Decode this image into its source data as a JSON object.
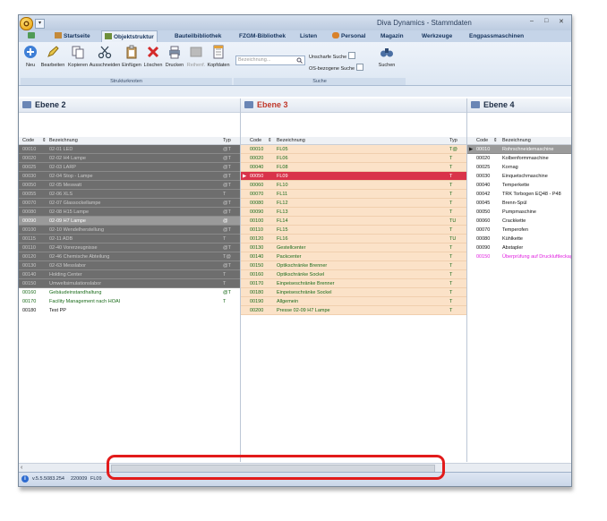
{
  "window_title": "Diva Dynamics - Stammdaten",
  "window_controls": [
    "–",
    "□",
    "✕"
  ],
  "quick_access": "▾",
  "tabs": [
    {
      "label": "Startseite"
    },
    {
      "label": "Objektstruktur"
    },
    {
      "label": "Bauteilbibliothek"
    },
    {
      "label": "FZGM-Bibliothek"
    },
    {
      "label": "Listen"
    },
    {
      "label": "Personal"
    },
    {
      "label": "Magazin"
    },
    {
      "label": "Werkzeuge"
    },
    {
      "label": "Engpassmaschinen"
    }
  ],
  "ribbon": {
    "buttons": [
      "Neu",
      "Bearbeiten",
      "Kopieren",
      "Ausschneiden",
      "Einfügen",
      "Löschen",
      "Drucken",
      "Reihenf.",
      "Kopfdaten"
    ],
    "group_struktur": "Strukturknoten",
    "search_placeholder": "Bezeichnung...",
    "unscharfe_suche": "Unscharfe Suche",
    "os_suche": "OS-bezogene Suche",
    "suchen": "Suchen",
    "group_suche": "Suche"
  },
  "panels": {
    "ebene2": {
      "title": "Ebene 2",
      "col_code": "Code",
      "col_bez": "Bezeichnung",
      "col_typ": "Typ",
      "rows": [
        {
          "code": "00010",
          "bez": "02-01 LED",
          "typ": "@T"
        },
        {
          "code": "00020",
          "bez": "02-02 H4 Lampe",
          "typ": "@T"
        },
        {
          "code": "00025",
          "bez": "02-03 LARP",
          "typ": "@T"
        },
        {
          "code": "00030",
          "bez": "02-04 Stop - Lampe",
          "typ": "@T"
        },
        {
          "code": "00050",
          "bez": "02-05 Meswatt",
          "typ": "@T"
        },
        {
          "code": "00055",
          "bez": "02-06 XLS",
          "typ": "T"
        },
        {
          "code": "00070",
          "bez": "02-07 Glassockellampe",
          "typ": "@T"
        },
        {
          "code": "00080",
          "bez": "02-08 H15 Lampe",
          "typ": "@T"
        },
        {
          "code": "00090",
          "bez": "02-09 H7 Lampe",
          "typ": "@"
        },
        {
          "code": "00100",
          "bez": "02-10 Wendelherstellung",
          "typ": "@T"
        },
        {
          "code": "00115",
          "bez": "02-11 ADB",
          "typ": "T"
        },
        {
          "code": "00110",
          "bez": "02-40 Vorerzeugnisse",
          "typ": "@T"
        },
        {
          "code": "00120",
          "bez": "02-46 Chemische Abteilung",
          "typ": "T@"
        },
        {
          "code": "00130",
          "bez": "02-63 Messlabor",
          "typ": "@T"
        },
        {
          "code": "00140",
          "bez": "Holding Center",
          "typ": "T"
        },
        {
          "code": "00150",
          "bez": "Umweltsimulationslabor",
          "typ": "T"
        },
        {
          "code": "00160",
          "bez": "Gebäudeinstandhaltung",
          "typ": "@T"
        },
        {
          "code": "00170",
          "bez": "Facility Management nach HOAI",
          "typ": "T"
        },
        {
          "code": "00180",
          "bez": "Test PP",
          "typ": ""
        }
      ]
    },
    "ebene3": {
      "title": "Ebene 3",
      "col_code": "Code",
      "col_bez": "Bezeichnung",
      "col_typ": "Typ",
      "rows": [
        {
          "code": "00010",
          "bez": "FL05",
          "typ": "T@"
        },
        {
          "code": "00020",
          "bez": "FL06",
          "typ": "T"
        },
        {
          "code": "00040",
          "bez": "FL08",
          "typ": "T"
        },
        {
          "code": "00050",
          "bez": "FL09",
          "typ": "T"
        },
        {
          "code": "00060",
          "bez": "FL10",
          "typ": "T"
        },
        {
          "code": "00070",
          "bez": "FL11",
          "typ": "T"
        },
        {
          "code": "00080",
          "bez": "FL12",
          "typ": "T"
        },
        {
          "code": "00090",
          "bez": "FL13",
          "typ": "T"
        },
        {
          "code": "00100",
          "bez": "FL14",
          "typ": "TU"
        },
        {
          "code": "00110",
          "bez": "FL15",
          "typ": "T"
        },
        {
          "code": "00120",
          "bez": "FL16",
          "typ": "TU"
        },
        {
          "code": "00130",
          "bez": "Gestellcenter",
          "typ": "T"
        },
        {
          "code": "00140",
          "bez": "Packcenter",
          "typ": "T"
        },
        {
          "code": "00150",
          "bez": "Optikschränke Brenner",
          "typ": "T"
        },
        {
          "code": "00160",
          "bez": "Optikschränke Sockel",
          "typ": "T"
        },
        {
          "code": "00170",
          "bez": "Einpeiseschränke Brenner",
          "typ": "T"
        },
        {
          "code": "00180",
          "bez": "Einpeiseschränke Sockel",
          "typ": "T"
        },
        {
          "code": "00190",
          "bez": "Allgemein",
          "typ": "T"
        },
        {
          "code": "00200",
          "bez": "Presse 02-09 H7 Lampe",
          "typ": "T"
        }
      ]
    },
    "ebene4": {
      "title": "Ebene 4",
      "col_code": "Code",
      "col_bez": "Bezeichnung",
      "rows": [
        {
          "code": "00010",
          "bez": "Rohrschneidemaschine"
        },
        {
          "code": "00020",
          "bez": "Kolbenformmaschine"
        },
        {
          "code": "00025",
          "bez": "Kornag"
        },
        {
          "code": "00030",
          "bez": "Einquetschmaschine"
        },
        {
          "code": "00040",
          "bez": "Temperkette"
        },
        {
          "code": "00042",
          "bez": "TRK Torbogen EQ48 - P48"
        },
        {
          "code": "00045",
          "bez": "Brenn-Spül"
        },
        {
          "code": "00050",
          "bez": "Pumpmaschine"
        },
        {
          "code": "00060",
          "bez": "Crackkette"
        },
        {
          "code": "00070",
          "bez": "Temperofen"
        },
        {
          "code": "00080",
          "bez": "Kühlkette"
        },
        {
          "code": "00090",
          "bez": "Abstapler"
        },
        {
          "code": "00150",
          "bez": "Überprüfung auf Druckluftleckage"
        }
      ]
    }
  },
  "scrollbar_arrow": "‹",
  "status": {
    "info_icon": "i",
    "version": "v.5.5.5083.254",
    "code": "220009",
    "item": "FL09"
  }
}
